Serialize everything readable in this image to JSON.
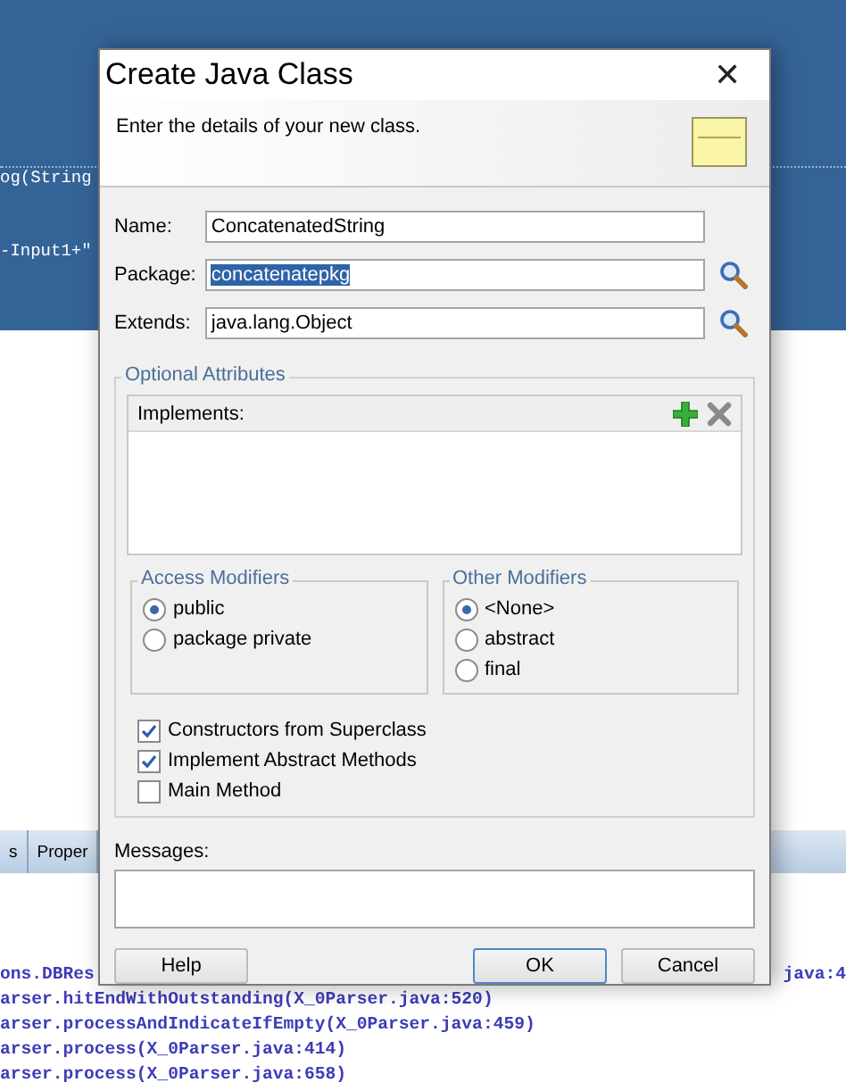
{
  "editor": {
    "lines": [
      "og(String",
      "-Input1+\""
    ]
  },
  "panel_tabs": [
    {
      "label": "s",
      "selected": false
    },
    {
      "label": "Proper",
      "selected": false
    }
  ],
  "console": {
    "lines": [
      {
        "left": "ons.DBRes",
        "right": "java:4"
      },
      {
        "left": "arser.hitEndWithOutstanding(X_0Parser.java:520)"
      },
      {
        "left": "arser.processAndIndicateIfEmpty(X_0Parser.java:459)"
      },
      {
        "left": "arser.process(X_0Parser.java:414)"
      },
      {
        "left": "arser.process(X_0Parser.java:658)"
      }
    ]
  },
  "dialog": {
    "title": "Create Java Class",
    "close": "✕",
    "description": "Enter the details of your new class.",
    "fields": [
      {
        "label": "Name:",
        "value": "ConcatenatedString",
        "selected": false,
        "browse": false
      },
      {
        "label": "Package:",
        "value": "concatenatepkg",
        "selected": true,
        "browse": true
      },
      {
        "label": "Extends:",
        "value": "java.lang.Object",
        "selected": false,
        "browse": true
      }
    ],
    "optional_attributes": {
      "title": "Optional Attributes",
      "implements_label": "Implements:",
      "groups": [
        {
          "title": "Access Modifiers",
          "options": [
            {
              "label": "public",
              "selected": true
            },
            {
              "label": "package private",
              "selected": false
            }
          ]
        },
        {
          "title": "Other Modifiers",
          "options": [
            {
              "label": "<None>",
              "selected": true
            },
            {
              "label": "abstract",
              "selected": false
            },
            {
              "label": "final",
              "selected": false
            }
          ]
        }
      ],
      "checkboxes": [
        {
          "label": "Constructors from Superclass",
          "checked": true
        },
        {
          "label": "Implement Abstract Methods",
          "checked": true
        },
        {
          "label": "Main Method",
          "checked": false
        }
      ]
    },
    "messages_label": "Messages:",
    "buttons": [
      {
        "label": "Help",
        "kind": "help"
      },
      {
        "label": "OK",
        "kind": "default"
      },
      {
        "label": "Cancel",
        "kind": "normal"
      }
    ]
  }
}
